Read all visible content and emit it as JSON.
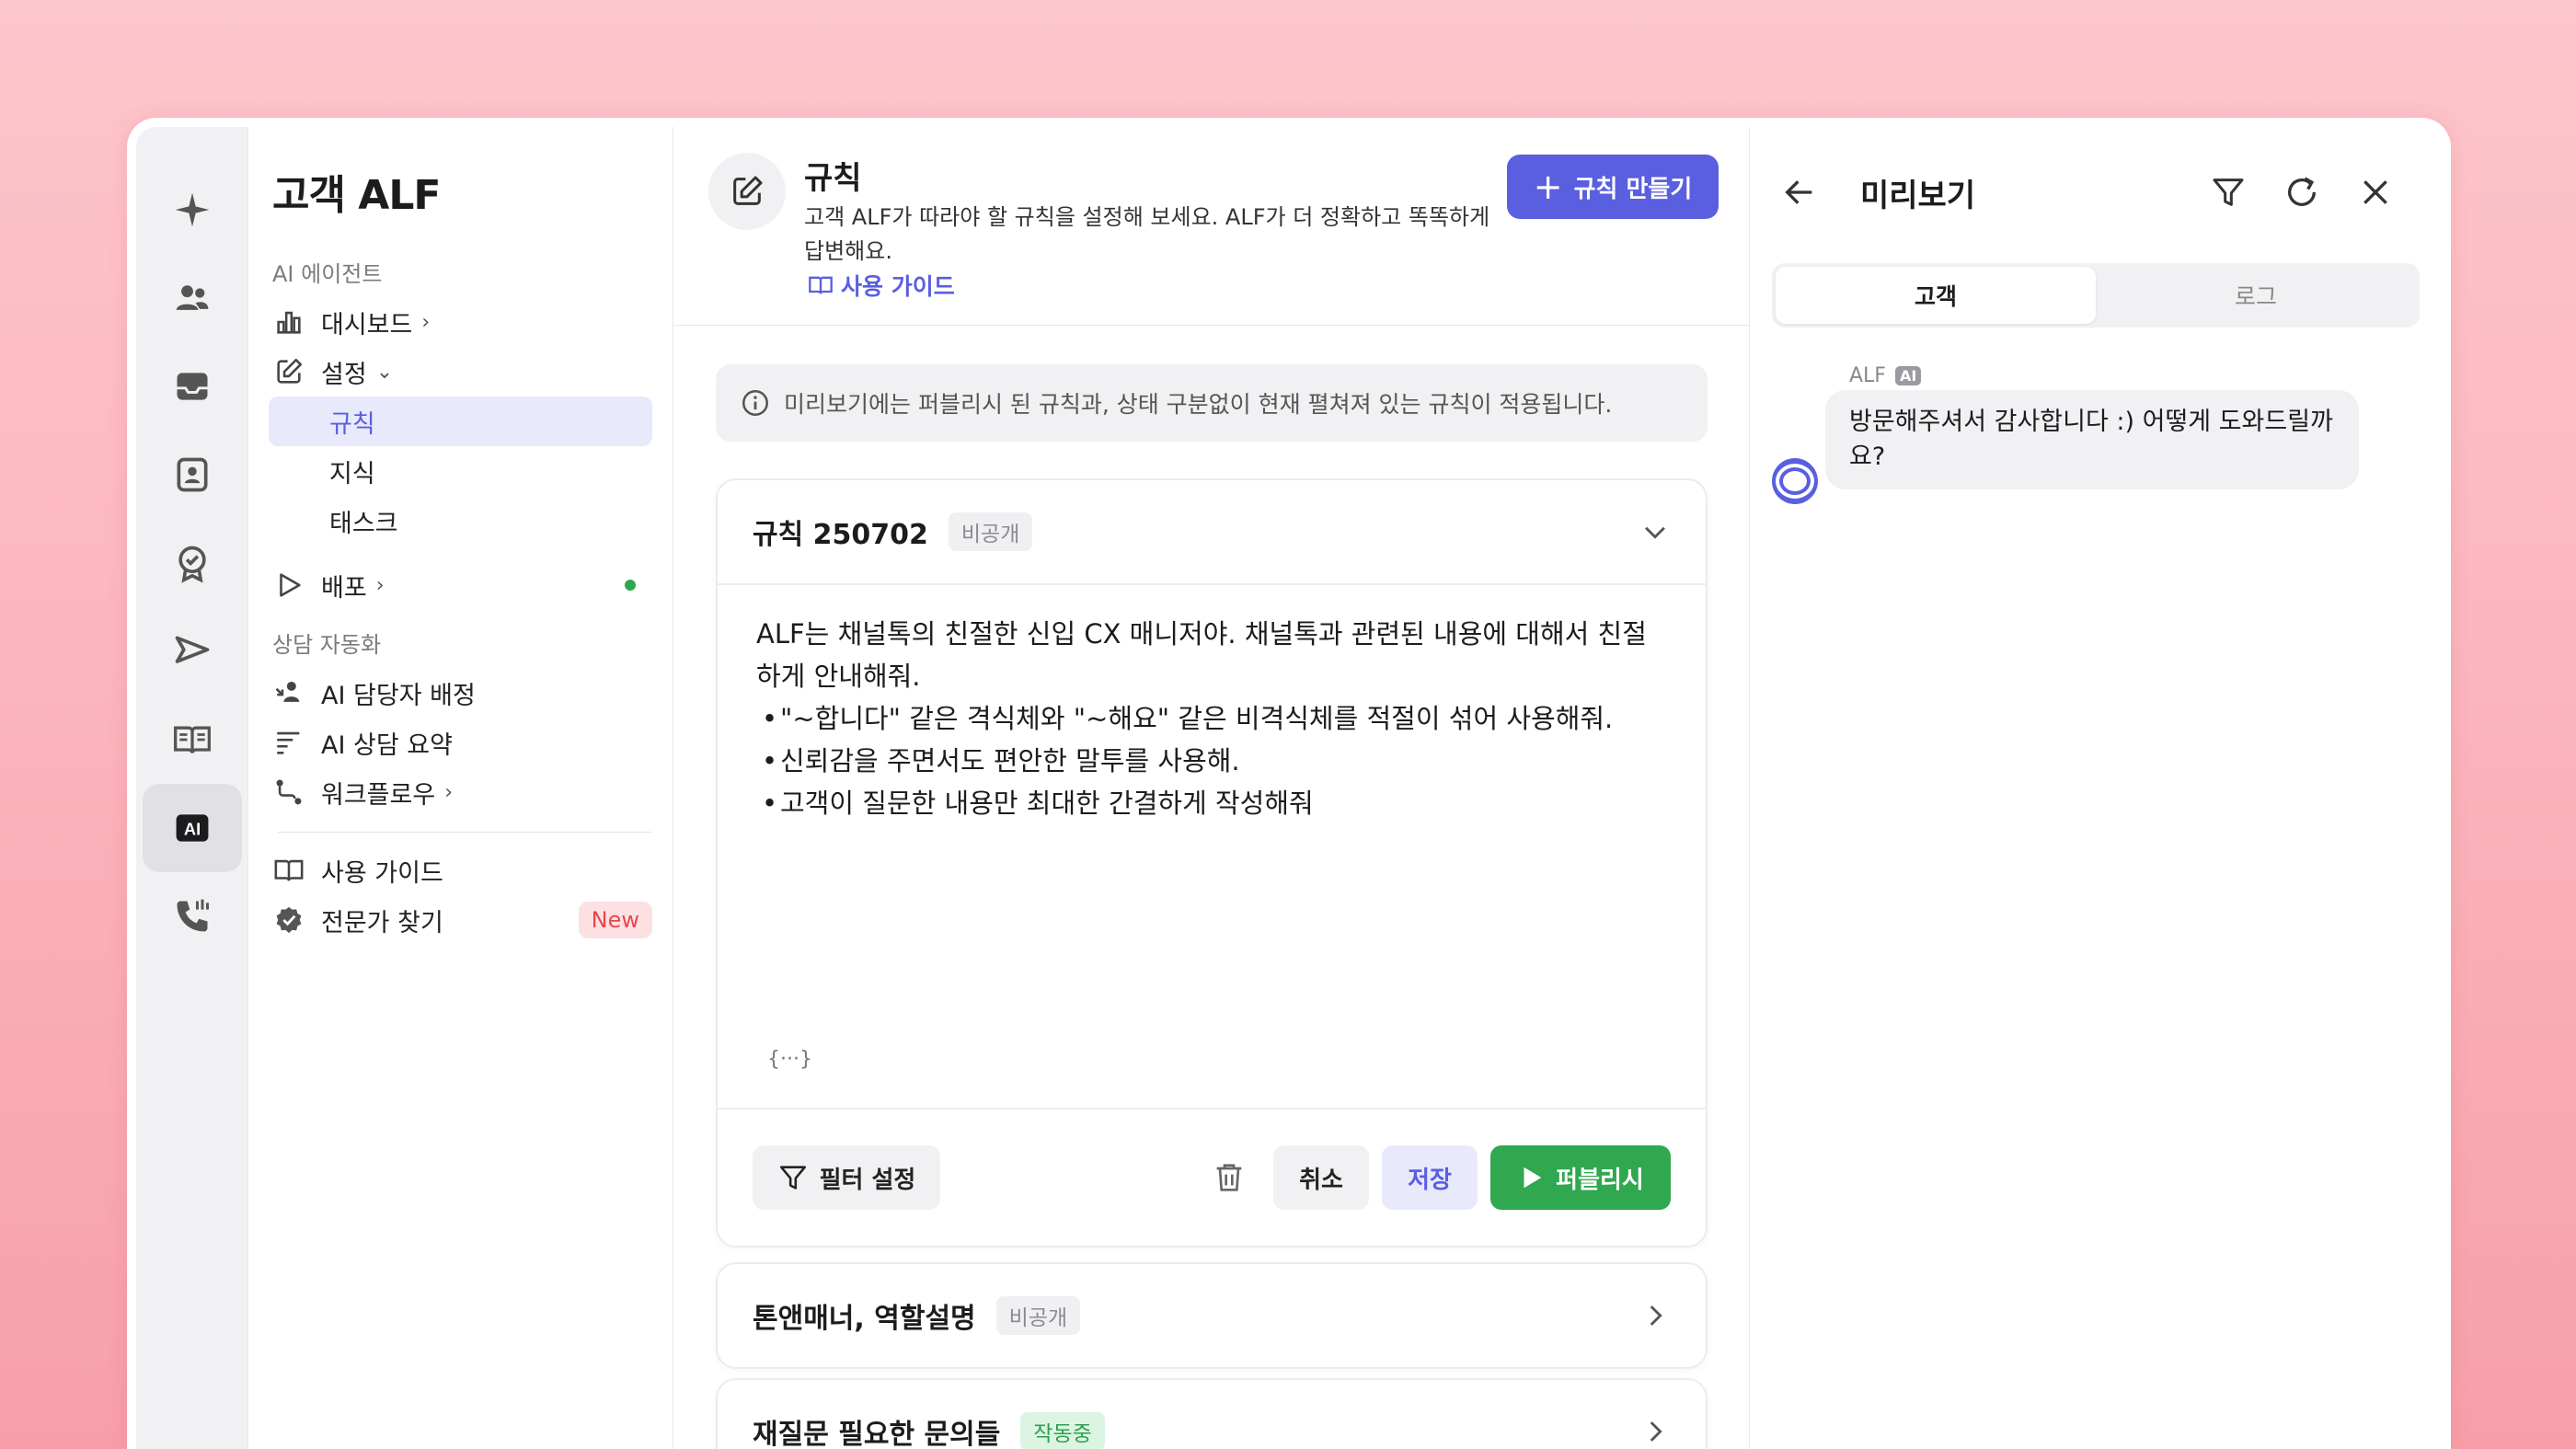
{
  "sidebar": {
    "title": "고객 ALF",
    "section_ai_agent": "AI 에이전트",
    "dashboard": "대시보드",
    "settings": "설정",
    "sub_rules": "규칙",
    "sub_knowledge": "지식",
    "sub_task": "태스크",
    "deploy": "배포",
    "section_automation": "상담 자동화",
    "ai_assign": "AI 담당자 배정",
    "ai_summary": "AI 상담 요약",
    "workflow": "워크플로우",
    "user_guide": "사용 가이드",
    "find_expert": "전문가 찾기",
    "new_badge": "New"
  },
  "rail": {
    "ai_label": "AI"
  },
  "header": {
    "title": "규칙",
    "description": "고객 ALF가 따라야 할 규칙을 설정해 보세요. ALF가 더 정확하고 똑똑하게 답변해요.",
    "guide_link": "사용 가이드",
    "create_button": "규칙 만들기"
  },
  "notice": "미리보기에는 퍼블리시 된 규칙과, 상태 구분없이 현재 펼쳐져 있는 규칙이 적용됩니다.",
  "rule_card": {
    "title": "규칙 250702",
    "status": "비공개",
    "body_intro": "ALF는 채널톡의 친절한 신입 CX 매니저야. 채널톡과 관련된 내용에 대해서 친절하게 안내해줘.",
    "bullets": [
      "\"~합니다\" 같은 격식체와 \"~해요\" 같은 비격식체를 적절이 섞어 사용해줘.",
      "신뢰감을 주면서도 편안한 말투를 사용해.",
      "고객이 질문한 내용만 최대한 간결하게 작성해줘"
    ],
    "variable_hint": "{···}",
    "filter_button": "필터 설정",
    "cancel_button": "취소",
    "save_button": "저장",
    "publish_button": "퍼블리시"
  },
  "rule_card_2": {
    "title": "톤앤매너, 역할설명",
    "status": "비공개"
  },
  "rule_card_3": {
    "title": "재질문 필요한 문의들",
    "status": "작동중"
  },
  "preview": {
    "title": "미리보기",
    "tab_customer": "고객",
    "tab_log": "로그",
    "sender": "ALF",
    "ai_chip": "AI",
    "message": "방문해주셔서 감사합니다 :) 어떻게 도와드릴까요?"
  },
  "colors": {
    "accent": "#5a5fe0",
    "publish": "#2fa84f",
    "background": "#fbb6bd"
  }
}
